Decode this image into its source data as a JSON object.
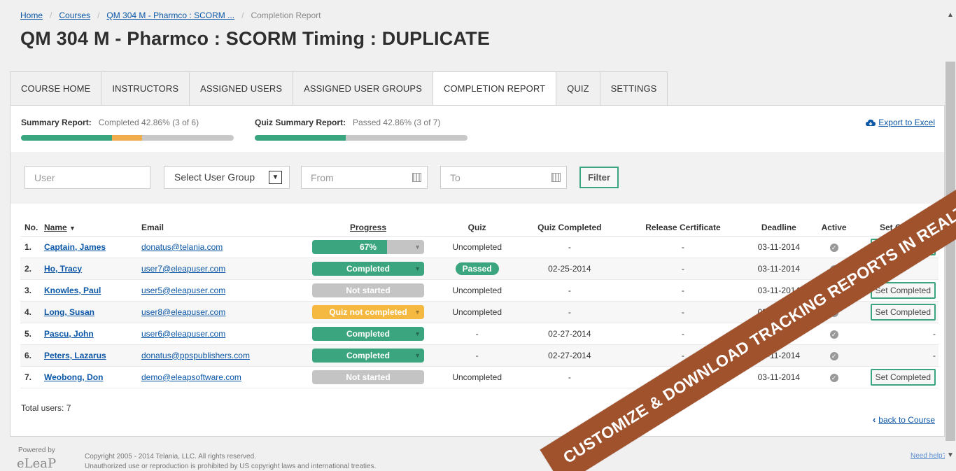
{
  "breadcrumb": {
    "home": "Home",
    "courses": "Courses",
    "course": "QM 304 M - Pharmco : SCORM ...",
    "current": "Completion Report",
    "separator": "/"
  },
  "page_title": "QM 304 M - Pharmco : SCORM Timing : DUPLICATE",
  "tabs": [
    {
      "label": "COURSE HOME"
    },
    {
      "label": "INSTRUCTORS"
    },
    {
      "label": "ASSIGNED USERS"
    },
    {
      "label": "ASSIGNED USER GROUPS"
    },
    {
      "label": "COMPLETION REPORT"
    },
    {
      "label": "QUIZ"
    },
    {
      "label": "SETTINGS"
    }
  ],
  "summary": {
    "label": "Summary Report:",
    "value": "Completed 42.86% (3 of 6)",
    "completed_fraction": 0.4286,
    "partial_fraction": 0.14
  },
  "quiz_summary": {
    "label": "Quiz Summary Report:",
    "value": "Passed 42.86% (3 of 7)",
    "passed_fraction": 0.4286
  },
  "export": {
    "label": "Export to Excel",
    "icon": "cloud-download-icon"
  },
  "filters": {
    "user_placeholder": "User",
    "group_select": "Select User Group",
    "from_placeholder": "From",
    "to_placeholder": "To",
    "filter_button": "Filter"
  },
  "table": {
    "headers": {
      "no": "No.",
      "name": "Name",
      "email": "Email",
      "progress": "Progress",
      "quiz": "Quiz",
      "quiz_completed": "Quiz Completed",
      "release_certificate": "Release Certificate",
      "deadline": "Deadline",
      "active": "Active",
      "set_completed": "Set Completed"
    },
    "rows": [
      {
        "no": "1.",
        "name": "Captain, James",
        "email": "donatus@telania.com",
        "progress": "67%",
        "progress_value": 0.67,
        "progress_state": "partial",
        "quiz": "Uncompleted",
        "quiz_badge": false,
        "quiz_completed": "-",
        "release": "-",
        "deadline": "03-11-2014",
        "set": "Set Completed"
      },
      {
        "no": "2.",
        "name": "Ho, Tracy",
        "email": "user7@eleapuser.com",
        "progress": "Completed",
        "progress_value": 1,
        "progress_state": "completed",
        "quiz": "Passed",
        "quiz_badge": true,
        "quiz_completed": "02-25-2014",
        "release": "-",
        "deadline": "03-11-2014",
        "set": ""
      },
      {
        "no": "3.",
        "name": "Knowles, Paul",
        "email": "user5@eleapuser.com",
        "progress": "Not started",
        "progress_value": 0,
        "progress_state": "not-started",
        "quiz": "Uncompleted",
        "quiz_badge": false,
        "quiz_completed": "-",
        "release": "-",
        "deadline": "03-11-2014",
        "set": "Set Completed"
      },
      {
        "no": "4.",
        "name": "Long, Susan",
        "email": "user8@eleapuser.com",
        "progress": "Quiz not completed",
        "progress_value": 1,
        "progress_state": "quiz-pending",
        "quiz": "Uncompleted",
        "quiz_badge": false,
        "quiz_completed": "-",
        "release": "-",
        "deadline": "03-11-2014",
        "set": "Set Completed"
      },
      {
        "no": "5.",
        "name": "Pascu, John",
        "email": "user6@eleapuser.com",
        "progress": "Completed",
        "progress_value": 1,
        "progress_state": "completed",
        "quiz": "-",
        "quiz_badge": false,
        "quiz_completed": "02-27-2014",
        "release": "-",
        "deadline": "03-11-2014",
        "set": "-"
      },
      {
        "no": "6.",
        "name": "Peters, Lazarus",
        "email": "donatus@ppspublishers.com",
        "progress": "Completed",
        "progress_value": 1,
        "progress_state": "completed",
        "quiz": "-",
        "quiz_badge": false,
        "quiz_completed": "02-27-2014",
        "release": "-",
        "deadline": "03-11-2014",
        "set": "-"
      },
      {
        "no": "7.",
        "name": "Weobong, Don",
        "email": "demo@eleapsoftware.com",
        "progress": "Not started",
        "progress_value": 0,
        "progress_state": "not-started",
        "quiz": "Uncompleted",
        "quiz_badge": false,
        "quiz_completed": "-",
        "release": "-",
        "deadline": "03-11-2014",
        "set": "Set Completed"
      }
    ]
  },
  "total_users": "Total users: 7",
  "back_link": "back to Course",
  "footer": {
    "powered_by": "Powered by",
    "logo": "eLeaP",
    "copyright": "Copyright 2005 - 2014 Telania, LLC. All rights reserved.",
    "notice": "Unauthorized use or reproduction is prohibited by US copyright laws and international treaties.",
    "help": "Need help?"
  },
  "ribbon": "CUSTOMIZE & DOWNLOAD TRACKING REPORTS IN REALTIME",
  "colors": {
    "green": "#3aa57e",
    "orange": "#f0ad4e",
    "yellow": "#f5b942",
    "gray": "#c4c4c4",
    "ribbon": "#a0522d",
    "link": "#0b57a6"
  }
}
